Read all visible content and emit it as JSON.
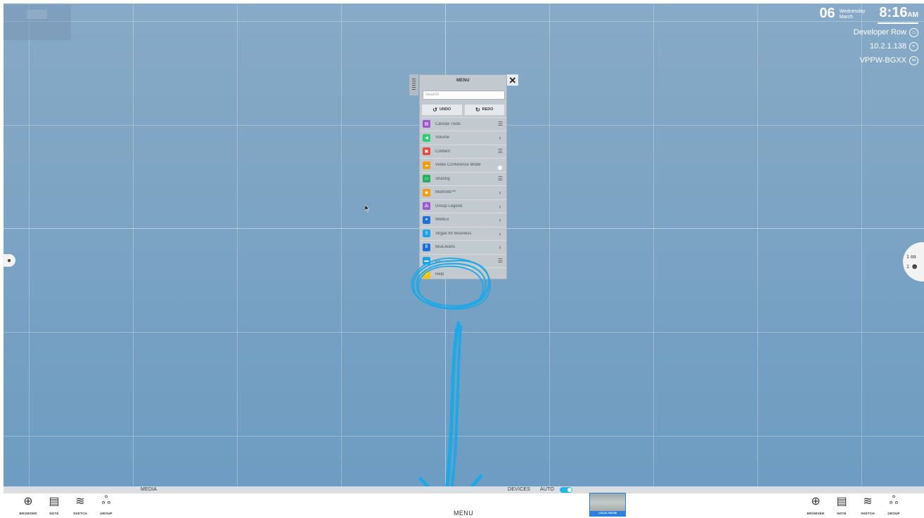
{
  "status": {
    "day": "06",
    "weekday": "Wednesday",
    "month": "March",
    "time": "8:16",
    "ampm": "AM",
    "room": "Developer Row",
    "ip": "10.2.1.138",
    "device_id": "VPPW-BGXX"
  },
  "side": {
    "right_count_1": "1",
    "right_count_2": "1"
  },
  "menu": {
    "title": "MENU",
    "close_glyph": "✕",
    "search_placeholder": "Search",
    "undo_label": "UNDO",
    "redo_label": "REDO",
    "items": [
      {
        "label": "Canvas Tools",
        "icon": "canvas-tools-icon",
        "color": "#9b59d0",
        "action": "list"
      },
      {
        "label": "Volume",
        "icon": "volume-icon",
        "color": "#2ecc71",
        "action": "chevron"
      },
      {
        "label": "Content",
        "icon": "content-icon",
        "color": "#e74c3c",
        "action": "list"
      },
      {
        "label": "Video Conference Mode",
        "icon": "video-conference-icon",
        "color": "#f39c12",
        "action": "toggle"
      },
      {
        "label": "Sharing",
        "icon": "sharing-icon",
        "color": "#27ae60",
        "action": "list"
      },
      {
        "label": "MultiSite™",
        "icon": "multisite-icon",
        "color": "#f39c12",
        "action": "chevron"
      },
      {
        "label": "Group Legend",
        "icon": "group-legend-icon",
        "color": "#9b59d0",
        "action": "chevron"
      },
      {
        "label": "WebEx",
        "icon": "webex-icon",
        "color": "#1e6fd9",
        "action": "chevron"
      },
      {
        "label": "Skype for Business",
        "icon": "skype-icon",
        "color": "#1ea1e8",
        "action": "chevron"
      },
      {
        "label": "BlueJeans",
        "icon": "bluejeans-icon",
        "color": "#1e6fd9",
        "action": "chevron"
      },
      {
        "label": "Zo...",
        "icon": "zoom-icon",
        "color": "#1ea1e8",
        "action": "list"
      },
      {
        "label": "Help",
        "icon": "help-icon",
        "color": "#f1c40f",
        "action": "none"
      }
    ]
  },
  "bottom": {
    "media_label": "MEDIA",
    "devices_label": "DEVICES",
    "auto_label": "AUTO",
    "menu_label": "MENU",
    "local_room_label": "LOCAL ROOM",
    "tools_left": [
      {
        "label": "BROWSER",
        "icon": "globe-icon"
      },
      {
        "label": "NOTE",
        "icon": "note-icon"
      },
      {
        "label": "SKETCH",
        "icon": "sketch-icon"
      },
      {
        "label": "GROUP",
        "icon": "group-icon"
      }
    ],
    "tools_right": [
      {
        "label": "BROWSER",
        "icon": "globe-icon"
      },
      {
        "label": "NOTE",
        "icon": "note-icon"
      },
      {
        "label": "SKETCH",
        "icon": "sketch-icon"
      },
      {
        "label": "GROUP",
        "icon": "group-icon"
      }
    ]
  },
  "colors": {
    "canvas": "#7fa5c4",
    "annotation": "#1fa8e6",
    "accent": "#27b4e8"
  }
}
